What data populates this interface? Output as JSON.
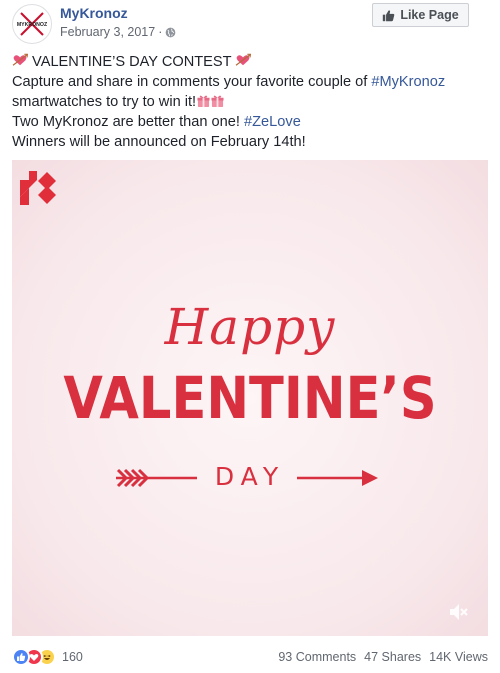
{
  "post": {
    "page_name": "MyKronoz",
    "date": "February 3, 2017",
    "date_separator": "·",
    "avatar_text": "MYKRONOZ",
    "like_page_label": "Like Page",
    "text": {
      "line1": " VALENTINE’S DAY CONTEST ",
      "line2_before": "Capture and share in comments your favorite couple of ",
      "line2_hashtag": "#MyKronoz",
      "line3": "smartwatches to try to win it!",
      "line4_before": "Two MyKronoz are better than one! ",
      "line4_hashtag": "#ZeLove",
      "line5": "Winners will be announced on February 14th!"
    }
  },
  "video": {
    "line_happy": "Happy",
    "line_valentine": "VALENTINE’S",
    "line_day": "DAY",
    "accent_color": "#d8303f",
    "background_color": "#fbeef0"
  },
  "footer": {
    "reaction_count": "160",
    "comments": "93 Comments",
    "shares": "47 Shares",
    "views": "14K Views"
  },
  "icons": {
    "globe": "globe-icon",
    "thumbs_up": "thumbs-up-icon",
    "mute": "speaker-muted-icon",
    "heart_arrow": "heart-with-arrow-emoji",
    "gift": "gift-emoji"
  },
  "colors": {
    "link": "#365899",
    "text": "#1d2129",
    "meta": "#616770",
    "like_blue": "#4c83f5",
    "love_red": "#f0364c",
    "haha_yellow": "#fbd24d"
  }
}
